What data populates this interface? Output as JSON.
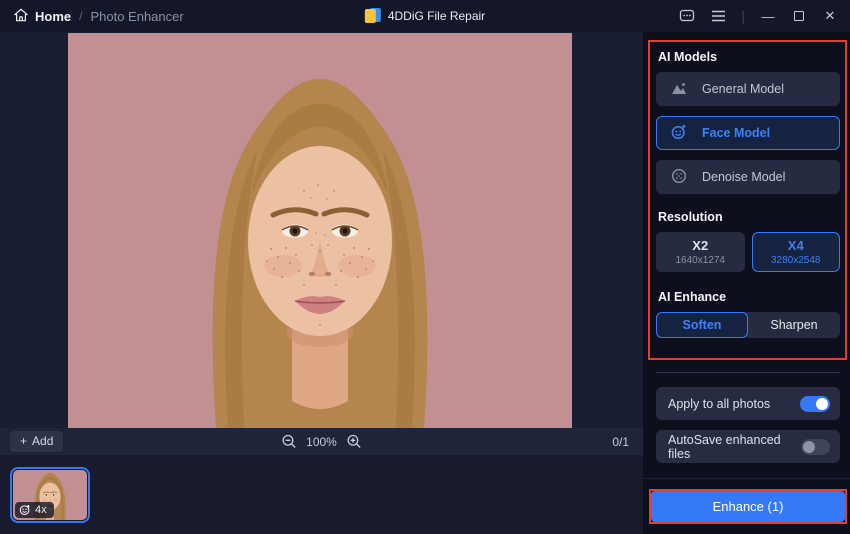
{
  "titlebar": {
    "home_label": "Home",
    "breadcrumb_sep": "/",
    "page_label": "Photo Enhancer",
    "app_title": "4DDiG File Repair"
  },
  "sidebar": {
    "ai_models": {
      "heading": "AI Models",
      "items": [
        {
          "label": "General Model",
          "icon": "image-model-icon",
          "selected": false
        },
        {
          "label": "Face Model",
          "icon": "face-model-icon",
          "selected": true
        },
        {
          "label": "Denoise Model",
          "icon": "denoise-model-icon",
          "selected": false
        }
      ]
    },
    "resolution": {
      "heading": "Resolution",
      "options": [
        {
          "label": "X2",
          "sub": "1640x1274",
          "selected": false
        },
        {
          "label": "X4",
          "sub": "3280x2548",
          "selected": true
        }
      ]
    },
    "ai_enhance": {
      "heading": "AI Enhance",
      "options": [
        {
          "label": "Soften",
          "selected": true
        },
        {
          "label": "Sharpen",
          "selected": false
        }
      ]
    },
    "toggles": [
      {
        "label": "Apply to all photos",
        "on": true
      },
      {
        "label": "AutoSave enhanced files",
        "on": false
      }
    ],
    "enhance_button": "Enhance (1)"
  },
  "viewer": {
    "add_plus": "+",
    "add_label": "Add",
    "zoom_level": "100%",
    "counter": "0/1"
  },
  "filmstrip": {
    "scale_badge": "4x"
  },
  "colors": {
    "accent_blue": "#3579f6",
    "highlight_red": "#e73b2e",
    "photo_background": "#c28f92",
    "sidebar_background": "#0d101c"
  }
}
